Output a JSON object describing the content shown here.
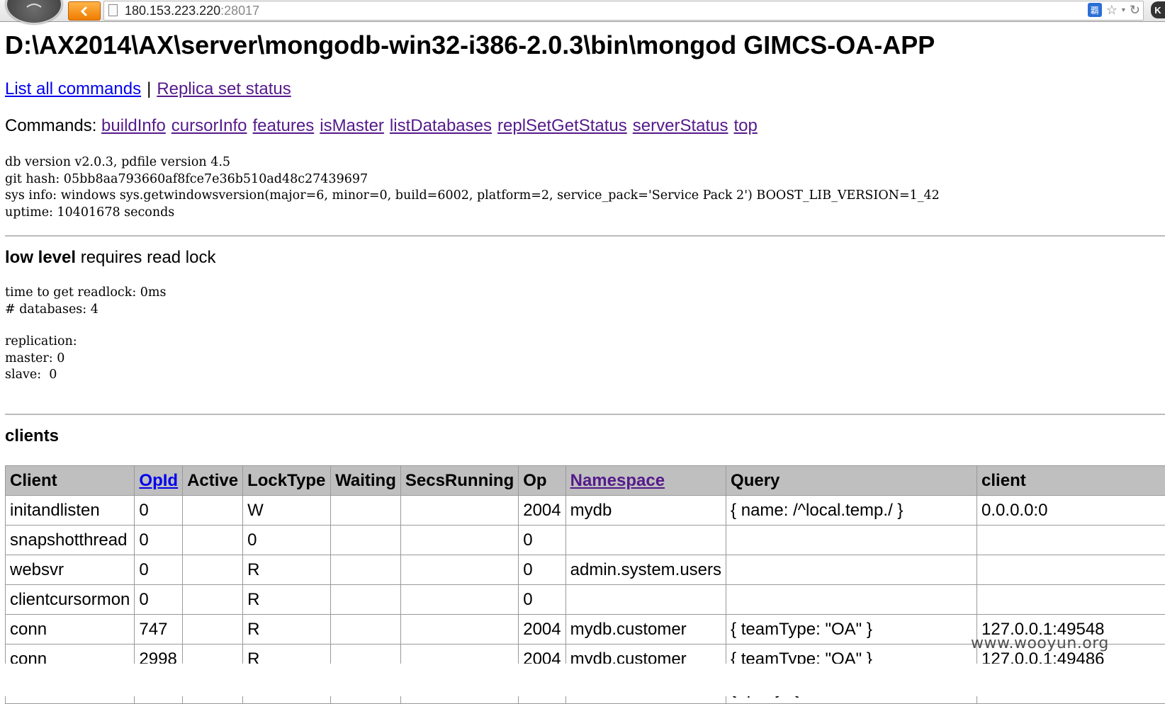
{
  "browser": {
    "url_host": "180.153.223.220",
    "url_port": ":28017",
    "extension_glyph": "覇",
    "star_glyph": "☆",
    "reload_glyph": "↻",
    "caret_glyph": "▾",
    "corner_glyph": "K"
  },
  "page": {
    "title": "D:\\AX2014\\AX\\server\\mongodb-win32-i386-2.0.3\\bin\\mongod GIMCS-OA-APP",
    "links": {
      "list_all_commands": "List all commands",
      "separator": "|",
      "replica_set_status": "Replica set status"
    },
    "commands_label": "Commands:",
    "commands": [
      "buildInfo",
      "cursorInfo",
      "features",
      "isMaster",
      "listDatabases",
      "replSetGetStatus",
      "serverStatus",
      "top"
    ],
    "info": {
      "db_version": "db version v2.0.3, pdfile version 4.5",
      "git_hash": "git hash: 05bb8aa793660af8fce7e36b510ad48c27439697",
      "sys_info": "sys info: windows sys.getwindowsversion(major=6, minor=0, build=6002, platform=2, service_pack='Service Pack 2') BOOST_LIB_VERSION=1_42",
      "uptime": "uptime: 10401678 seconds"
    },
    "low_level": {
      "bold": "low level",
      "rest": " requires read lock",
      "readlock": "time to get readlock: 0ms",
      "databases": "# databases: 4"
    },
    "replication": {
      "label": "replication:",
      "master": "master: 0",
      "slave": "slave:  0"
    },
    "clients": {
      "heading": "clients",
      "columns": [
        "Client",
        "OpId",
        "Active",
        "LockType",
        "Waiting",
        "SecsRunning",
        "Op",
        "Namespace",
        "Query",
        "client"
      ],
      "rows": [
        [
          "initandlisten",
          "0",
          "",
          "W",
          "",
          "",
          "2004",
          "mydb",
          "{ name: /^local.temp./ }",
          "0.0.0.0:0"
        ],
        [
          "snapshotthread",
          "0",
          "",
          "0",
          "",
          "",
          "0",
          "",
          "",
          ""
        ],
        [
          "websvr",
          "0",
          "",
          "R",
          "",
          "",
          "0",
          "admin.system.users",
          "",
          ""
        ],
        [
          "clientcursormon",
          "0",
          "",
          "R",
          "",
          "",
          "0",
          "",
          "",
          ""
        ],
        [
          "conn",
          "747",
          "",
          "R",
          "",
          "",
          "2004",
          "mydb.customer",
          "{ teamType: \"OA\" }",
          "127.0.0.1:49548"
        ],
        [
          "conn",
          "2998",
          "",
          "R",
          "",
          "",
          "2004",
          "mydb.customer",
          "{ teamType: \"OA\" }",
          "127.0.0.1:49486"
        ],
        [
          "",
          "",
          "",
          "",
          "",
          "",
          "",
          "",
          "{ query: { folder: \"HC\", filename:",
          ""
        ]
      ]
    }
  },
  "watermark": "www.wooyun.org"
}
